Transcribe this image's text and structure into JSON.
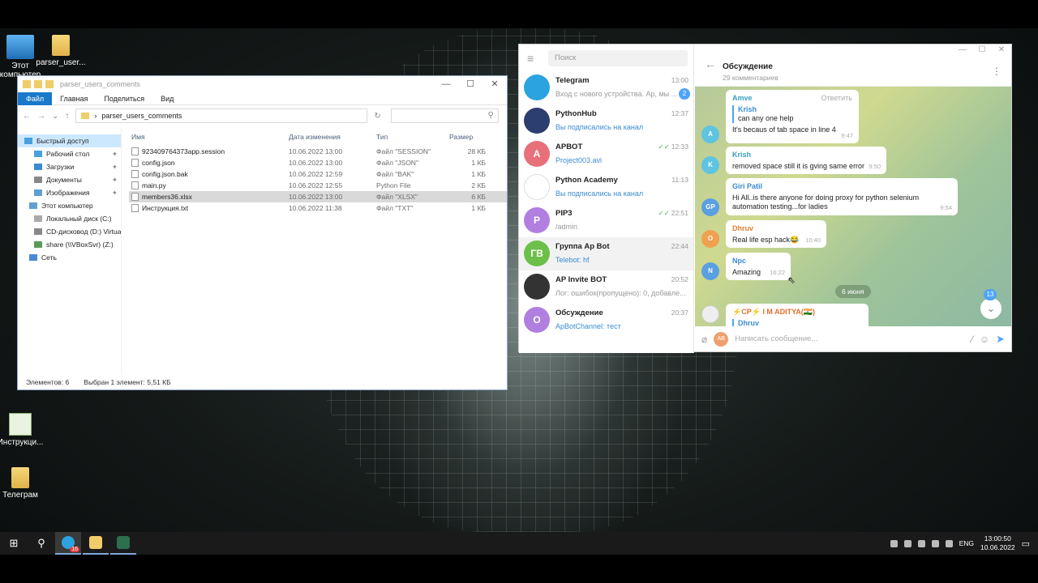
{
  "desktop_icons": [
    {
      "label": "Этот компьютер"
    },
    {
      "label": "parser_user..."
    },
    {
      "label": "Инструкци..."
    },
    {
      "label": "Телеграм"
    }
  ],
  "explorer": {
    "title": "parser_users_comments",
    "ribbon": [
      "Файл",
      "Главная",
      "Поделиться",
      "Вид"
    ],
    "path": "parser_users_comments",
    "nav": [
      {
        "label": "Быстрый доступ",
        "selected": true
      },
      {
        "label": "Рабочий стол",
        "pinned": true
      },
      {
        "label": "Загрузки",
        "pinned": true
      },
      {
        "label": "Документы",
        "pinned": true
      },
      {
        "label": "Изображения",
        "pinned": true
      },
      {
        "label": "Этот компьютер"
      },
      {
        "label": "Локальный диск (C:)"
      },
      {
        "label": "CD-дисковод (D:) Virtua"
      },
      {
        "label": "share (\\\\VBoxSvr) (Z:)"
      },
      {
        "label": "Сеть"
      }
    ],
    "columns": [
      "Имя",
      "Дата изменения",
      "Тип",
      "Размер"
    ],
    "files": [
      {
        "name": "923409764373app.session",
        "date": "10.06.2022 13:00",
        "type": "Файл \"SESSION\"",
        "size": "28 КБ"
      },
      {
        "name": "config.json",
        "date": "10.06.2022 13:00",
        "type": "Файл \"JSON\"",
        "size": "1 КБ"
      },
      {
        "name": "config.json.bak",
        "date": "10.06.2022 12:59",
        "type": "Файл \"BAK\"",
        "size": "1 КБ"
      },
      {
        "name": "main.py",
        "date": "10.06.2022 12:55",
        "type": "Python File",
        "size": "2 КБ"
      },
      {
        "name": "members36.xlsx",
        "date": "10.06.2022 13:00",
        "type": "Файл \"XLSX\"",
        "size": "6 КБ",
        "selected": true
      },
      {
        "name": "Инструкция.txt",
        "date": "10.06.2022 11:38",
        "type": "Файл \"TXT\"",
        "size": "1 КБ"
      }
    ],
    "status_count": "Элементов: 6",
    "status_selected": "Выбран 1 элемент: 5,51 КБ"
  },
  "telegram": {
    "search_placeholder": "Поиск",
    "chats": [
      {
        "name": "Telegram",
        "preview": "Вход с нового устройства. Ар, мы ...",
        "time": "13:00",
        "badge": "2",
        "avatar_color": "#2aa3e0",
        "avatar_text": ""
      },
      {
        "name": "PythonHub",
        "preview": "Вы подписались на канал",
        "time": "12:37",
        "avatar_color": "#2c3e70",
        "avatar_text": ""
      },
      {
        "name": "APBOT",
        "preview": "Project003.avi",
        "time": "12:33",
        "avatar_color": "#e8707a",
        "avatar_text": "A",
        "checks": true
      },
      {
        "name": "Python Academy",
        "preview": "Вы подписались на канал",
        "time": "11:13",
        "avatar_color": "#ffffff",
        "avatar_text": ""
      },
      {
        "name": "PIP3",
        "preview": "/admin",
        "time": "22:51",
        "avatar_color": "#b07fe0",
        "avatar_text": "P",
        "checks": true
      },
      {
        "name": "Группа Ap Bot",
        "preview": "Telebot: hf",
        "time": "22:44",
        "avatar_color": "#6cc04a",
        "avatar_text": "ГВ",
        "selected": true
      },
      {
        "name": "AP Invite BOT",
        "preview": "Лог: ошибок(пропущено): 0, добавле...",
        "time": "20:52",
        "avatar_color": "#333333",
        "avatar_text": ""
      },
      {
        "name": "Обсуждение",
        "preview": "ApBotChannel: тест",
        "time": "20:37",
        "avatar_color": "#b07fe0",
        "avatar_text": "О"
      }
    ],
    "chat_title": "Обсуждение",
    "chat_subtitle": "29 комментариев",
    "messages": [
      {
        "author": "Amve",
        "reply_to": "Krish",
        "reply_text": "can any one help",
        "text": "It's becaus of tab space in line 4",
        "time": "9:47",
        "avatar": "A",
        "color": "#5ec4e0",
        "reply_label": "Ответить"
      },
      {
        "author": "Krish",
        "text": "removed space still it is gving same error",
        "time": "9:50",
        "avatar": "K",
        "color": "#5ec4e0"
      },
      {
        "author": "Giri Patil",
        "text": "Hi  All..is there anyone for doing proxy for python selenium automation testing...for ladies",
        "time": "9:54",
        "avatar": "GP",
        "color": "#5aa0e0"
      },
      {
        "author": "Dhruv",
        "text": "Real life esp hack😂",
        "time": "10:40",
        "avatar": "O",
        "color": "#f0a050"
      },
      {
        "author": "Npc",
        "text": "Amazing",
        "time": "16:22",
        "avatar": "N",
        "color": "#5aa0e0"
      },
      {
        "author": "⚡CP⚡ I M ADITYA(🇮🇳)",
        "reply_to": "Dhruv",
        "avatar": "",
        "color": "#e07030"
      }
    ],
    "day_label": "6 июня",
    "unread_count": "13",
    "input_placeholder": "Написать сообщение...",
    "input_avatar": "AB"
  },
  "taskbar": {
    "lang": "ENG",
    "time": "13:00:50",
    "date": "10.06.2022",
    "tg_badge": "16"
  }
}
